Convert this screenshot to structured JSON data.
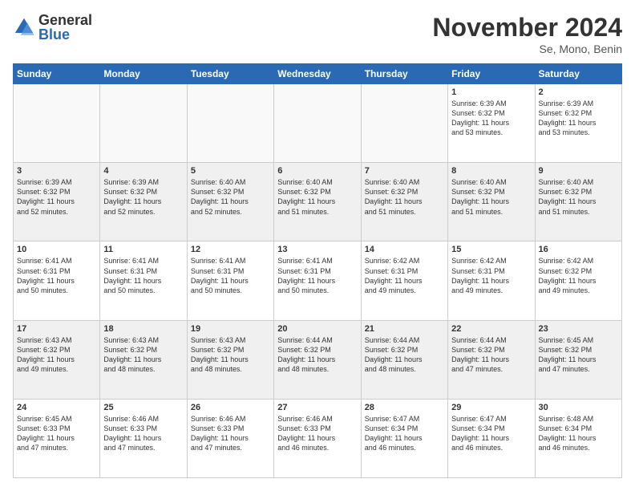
{
  "logo": {
    "line1": "General",
    "line2": "Blue"
  },
  "title": "November 2024",
  "subtitle": "Se, Mono, Benin",
  "days_of_week": [
    "Sunday",
    "Monday",
    "Tuesday",
    "Wednesday",
    "Thursday",
    "Friday",
    "Saturday"
  ],
  "weeks": [
    {
      "shade": false,
      "days": [
        {
          "num": "",
          "empty": true,
          "info": ""
        },
        {
          "num": "",
          "empty": true,
          "info": ""
        },
        {
          "num": "",
          "empty": true,
          "info": ""
        },
        {
          "num": "",
          "empty": true,
          "info": ""
        },
        {
          "num": "",
          "empty": true,
          "info": ""
        },
        {
          "num": "1",
          "empty": false,
          "info": "Sunrise: 6:39 AM\nSunset: 6:32 PM\nDaylight: 11 hours\nand 53 minutes."
        },
        {
          "num": "2",
          "empty": false,
          "info": "Sunrise: 6:39 AM\nSunset: 6:32 PM\nDaylight: 11 hours\nand 53 minutes."
        }
      ]
    },
    {
      "shade": true,
      "days": [
        {
          "num": "3",
          "empty": false,
          "info": "Sunrise: 6:39 AM\nSunset: 6:32 PM\nDaylight: 11 hours\nand 52 minutes."
        },
        {
          "num": "4",
          "empty": false,
          "info": "Sunrise: 6:39 AM\nSunset: 6:32 PM\nDaylight: 11 hours\nand 52 minutes."
        },
        {
          "num": "5",
          "empty": false,
          "info": "Sunrise: 6:40 AM\nSunset: 6:32 PM\nDaylight: 11 hours\nand 52 minutes."
        },
        {
          "num": "6",
          "empty": false,
          "info": "Sunrise: 6:40 AM\nSunset: 6:32 PM\nDaylight: 11 hours\nand 51 minutes."
        },
        {
          "num": "7",
          "empty": false,
          "info": "Sunrise: 6:40 AM\nSunset: 6:32 PM\nDaylight: 11 hours\nand 51 minutes."
        },
        {
          "num": "8",
          "empty": false,
          "info": "Sunrise: 6:40 AM\nSunset: 6:32 PM\nDaylight: 11 hours\nand 51 minutes."
        },
        {
          "num": "9",
          "empty": false,
          "info": "Sunrise: 6:40 AM\nSunset: 6:32 PM\nDaylight: 11 hours\nand 51 minutes."
        }
      ]
    },
    {
      "shade": false,
      "days": [
        {
          "num": "10",
          "empty": false,
          "info": "Sunrise: 6:41 AM\nSunset: 6:31 PM\nDaylight: 11 hours\nand 50 minutes."
        },
        {
          "num": "11",
          "empty": false,
          "info": "Sunrise: 6:41 AM\nSunset: 6:31 PM\nDaylight: 11 hours\nand 50 minutes."
        },
        {
          "num": "12",
          "empty": false,
          "info": "Sunrise: 6:41 AM\nSunset: 6:31 PM\nDaylight: 11 hours\nand 50 minutes."
        },
        {
          "num": "13",
          "empty": false,
          "info": "Sunrise: 6:41 AM\nSunset: 6:31 PM\nDaylight: 11 hours\nand 50 minutes."
        },
        {
          "num": "14",
          "empty": false,
          "info": "Sunrise: 6:42 AM\nSunset: 6:31 PM\nDaylight: 11 hours\nand 49 minutes."
        },
        {
          "num": "15",
          "empty": false,
          "info": "Sunrise: 6:42 AM\nSunset: 6:31 PM\nDaylight: 11 hours\nand 49 minutes."
        },
        {
          "num": "16",
          "empty": false,
          "info": "Sunrise: 6:42 AM\nSunset: 6:32 PM\nDaylight: 11 hours\nand 49 minutes."
        }
      ]
    },
    {
      "shade": true,
      "days": [
        {
          "num": "17",
          "empty": false,
          "info": "Sunrise: 6:43 AM\nSunset: 6:32 PM\nDaylight: 11 hours\nand 49 minutes."
        },
        {
          "num": "18",
          "empty": false,
          "info": "Sunrise: 6:43 AM\nSunset: 6:32 PM\nDaylight: 11 hours\nand 48 minutes."
        },
        {
          "num": "19",
          "empty": false,
          "info": "Sunrise: 6:43 AM\nSunset: 6:32 PM\nDaylight: 11 hours\nand 48 minutes."
        },
        {
          "num": "20",
          "empty": false,
          "info": "Sunrise: 6:44 AM\nSunset: 6:32 PM\nDaylight: 11 hours\nand 48 minutes."
        },
        {
          "num": "21",
          "empty": false,
          "info": "Sunrise: 6:44 AM\nSunset: 6:32 PM\nDaylight: 11 hours\nand 48 minutes."
        },
        {
          "num": "22",
          "empty": false,
          "info": "Sunrise: 6:44 AM\nSunset: 6:32 PM\nDaylight: 11 hours\nand 47 minutes."
        },
        {
          "num": "23",
          "empty": false,
          "info": "Sunrise: 6:45 AM\nSunset: 6:32 PM\nDaylight: 11 hours\nand 47 minutes."
        }
      ]
    },
    {
      "shade": false,
      "days": [
        {
          "num": "24",
          "empty": false,
          "info": "Sunrise: 6:45 AM\nSunset: 6:33 PM\nDaylight: 11 hours\nand 47 minutes."
        },
        {
          "num": "25",
          "empty": false,
          "info": "Sunrise: 6:46 AM\nSunset: 6:33 PM\nDaylight: 11 hours\nand 47 minutes."
        },
        {
          "num": "26",
          "empty": false,
          "info": "Sunrise: 6:46 AM\nSunset: 6:33 PM\nDaylight: 11 hours\nand 47 minutes."
        },
        {
          "num": "27",
          "empty": false,
          "info": "Sunrise: 6:46 AM\nSunset: 6:33 PM\nDaylight: 11 hours\nand 46 minutes."
        },
        {
          "num": "28",
          "empty": false,
          "info": "Sunrise: 6:47 AM\nSunset: 6:34 PM\nDaylight: 11 hours\nand 46 minutes."
        },
        {
          "num": "29",
          "empty": false,
          "info": "Sunrise: 6:47 AM\nSunset: 6:34 PM\nDaylight: 11 hours\nand 46 minutes."
        },
        {
          "num": "30",
          "empty": false,
          "info": "Sunrise: 6:48 AM\nSunset: 6:34 PM\nDaylight: 11 hours\nand 46 minutes."
        }
      ]
    }
  ]
}
